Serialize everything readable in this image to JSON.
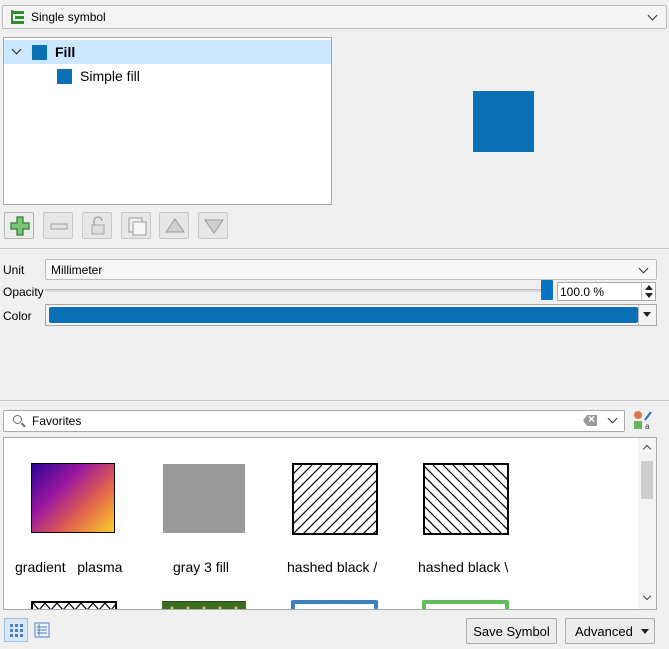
{
  "renderer": {
    "label": "Single symbol",
    "icon": "single-symbol-icon"
  },
  "layer_tree": {
    "items": [
      {
        "label": "Fill",
        "level": 0,
        "expanded": true,
        "selected": true
      },
      {
        "label": "Simple fill",
        "level": 1,
        "selected": false
      }
    ]
  },
  "colors": {
    "symbol_fill": "#0a6fb5",
    "selection": "#cce8ff"
  },
  "toolbar": {
    "buttons": [
      "add-layer",
      "remove-layer",
      "lock-layer",
      "duplicate-layer",
      "move-up",
      "move-down"
    ]
  },
  "properties": {
    "unit_label": "Unit",
    "unit_value": "Millimeter",
    "opacity_label": "Opacity",
    "opacity_value": "100.0 %",
    "opacity_fraction": 1.0,
    "color_label": "Color",
    "color_value": "#0a6fb5"
  },
  "search": {
    "value": "Favorites"
  },
  "symbols": [
    {
      "label": "gradient   plasma"
    },
    {
      "label": "gray 3 fill"
    },
    {
      "label": "hashed black /"
    },
    {
      "label": "hashed black \\"
    }
  ],
  "bottom": {
    "save_label": "Save Symbol",
    "advanced_label": "Advanced"
  }
}
